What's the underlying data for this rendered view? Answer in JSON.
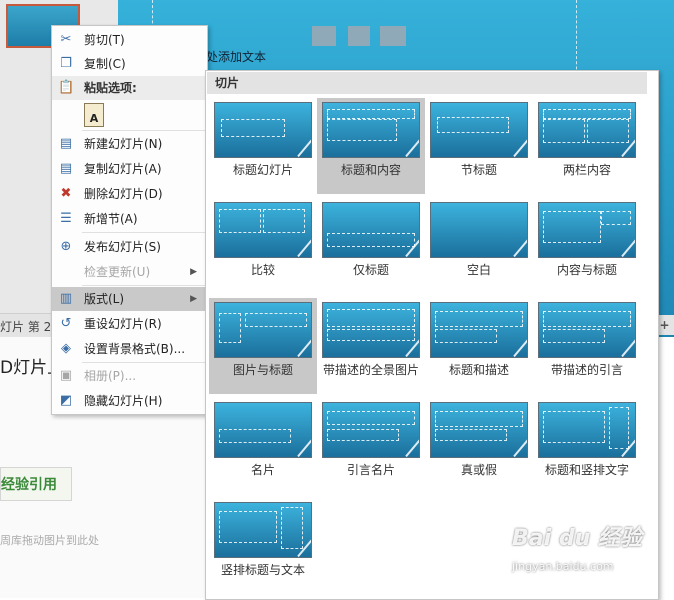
{
  "background": {
    "status_text": "灯片 第 2",
    "slide_placeholder_text": "处添加文本",
    "notes_text": "D灯片上",
    "citation_button": "经验引用",
    "drag_hint": "周库拖动图片到此处",
    "right_button": "+"
  },
  "context_menu": {
    "items": [
      {
        "icon": "scissors-icon",
        "label": "剪切(T)",
        "enabled": true
      },
      {
        "icon": "copy-icon",
        "label": "复制(C)",
        "enabled": true
      },
      {
        "icon": "clipboard-icon",
        "label": "粘贴选项:",
        "enabled": true
      },
      {
        "icon": "new-slide-icon",
        "label": "新建幻灯片(N)",
        "enabled": true
      },
      {
        "icon": "duplicate-slide-icon",
        "label": "复制幻灯片(A)",
        "enabled": true
      },
      {
        "icon": "delete-slide-icon",
        "label": "删除幻灯片(D)",
        "enabled": true
      },
      {
        "icon": "add-section-icon",
        "label": "新增节(A)",
        "enabled": true
      },
      {
        "icon": "publish-slide-icon",
        "label": "发布幻灯片(S)",
        "enabled": true
      },
      {
        "icon": "",
        "label": "检查更新(U)",
        "enabled": false,
        "submenu": true
      },
      {
        "icon": "layout-icon",
        "label": "版式(L)",
        "enabled": true,
        "submenu": true,
        "highlighted": true
      },
      {
        "icon": "reset-slide-icon",
        "label": "重设幻灯片(R)",
        "enabled": true
      },
      {
        "icon": "background-format-icon",
        "label": "设置背景格式(B)...",
        "enabled": true
      },
      {
        "icon": "album-icon",
        "label": "相册(P)...",
        "enabled": false
      },
      {
        "icon": "hide-slide-icon",
        "label": "隐藏幻灯片(H)",
        "enabled": true
      }
    ],
    "paste_icon_letter": "A"
  },
  "gallery": {
    "header": "切片",
    "selected_index": 1,
    "hover_index": 8,
    "layouts": [
      "标题幻灯片",
      "标题和内容",
      "节标题",
      "两栏内容",
      "比较",
      "仅标题",
      "空白",
      "内容与标题",
      "图片与标题",
      "带描述的全景图片",
      "标题和描述",
      "带描述的引言",
      "名片",
      "引言名片",
      "真或假",
      "标题和竖排文字",
      "竖排标题与文本"
    ]
  },
  "watermark": {
    "brand": "Bai du 经验",
    "url": "jingyan.baidu.com"
  },
  "colors": {
    "slide_top": "#3cb3dd",
    "slide_bottom": "#1b6f9c",
    "selection": "#c8c8c8",
    "accent_border": "#c55a3c"
  }
}
